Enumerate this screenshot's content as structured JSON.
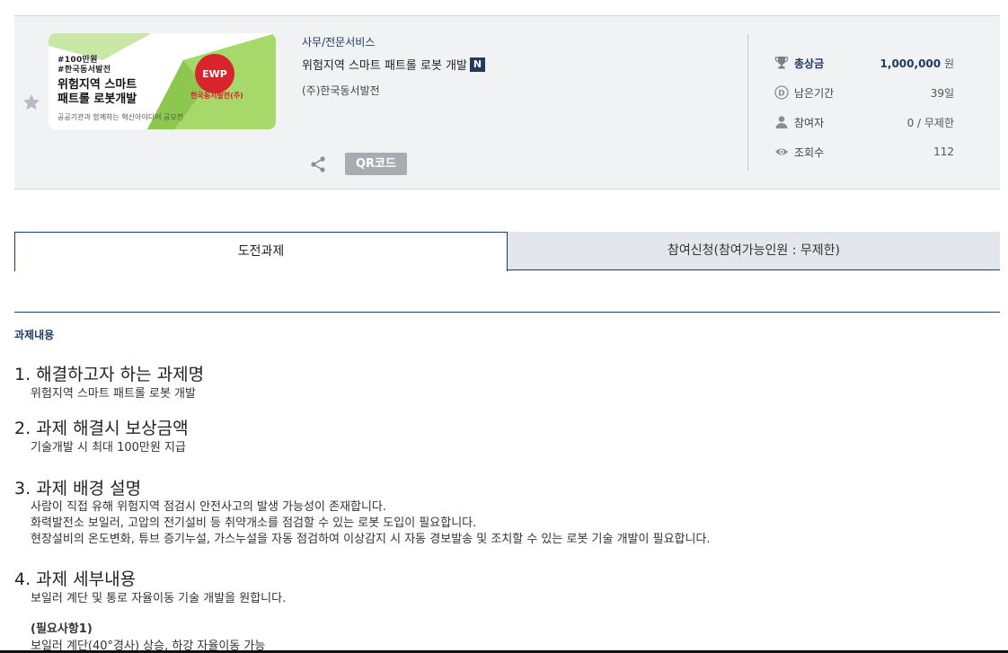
{
  "thumbnail": {
    "tags": "#100만원\n#한국동서발전",
    "headline": "위험지역 스마트\n패트롤 로봇개발",
    "footer": "공공기관과 함께하는 혁신아이디어 공모전",
    "logo_mark": "EWP",
    "logo_text": "한국동서발전(주)"
  },
  "project": {
    "category": "사무/전문서비스",
    "title": "위험지역 스마트 패트롤 로봇 개발",
    "new_badge": "N",
    "organization": "(주)한국동서발전"
  },
  "actions": {
    "qr_label": "QR코드"
  },
  "stats": {
    "prize_label": "총상금",
    "prize_value": "1,000,000",
    "prize_unit": "원",
    "remaining_label": "남은기간",
    "remaining_value": "39일",
    "participants_label": "참여자",
    "participants_value": "0 / 무제한",
    "views_label": "조회수",
    "views_value": "112"
  },
  "tabs": {
    "challenge": "도전과제",
    "apply": "참여신청(참여가능인원 : 무제한)"
  },
  "section": {
    "title": "과제내용",
    "h1": "1.  해결하고자 하는 과제명",
    "h1_body": "위험지역 스마트 패트롤 로봇 개발",
    "h2": "2.  과제 해결시 보상금액",
    "h2_body": "기술개발 시 최대 100만원 지급",
    "h3": "3.  과제 배경 설명",
    "h3_body1": "사람이 직접 유해 위험지역 점검시 안전사고의 발생 가능성이 존재합니다.",
    "h3_body2": "화력발전소 보일러, 고압의 전기설비 등 취약개소를 점검할 수 있는 로봇 도입이 필요합니다.",
    "h3_body3": "현장설비의 온도변화, 튜브 증기누설, 가스누설을 자동 점검하여 이상감지 시 자동 경보발송 및 조치할 수 있는 로봇 기술 개발이 필요합니다.",
    "h4": "4.  과제 세부내용",
    "h4_body": "보일러 계단 및 통로 자율이동 기술 개발을 원합니다.",
    "req1_title": "(필요사항1)",
    "req1_body": "보일러 계단(40°경사) 상승, 하강 자율이동 가능"
  },
  "colors": {
    "navy": "#1d3b63",
    "panel_bg": "#f1f2f4",
    "qr_button": "#a9abb0",
    "tab_inactive": "#e3e6ea",
    "thumb_green": "#a6d86a",
    "thumb_red": "#d9232d"
  }
}
